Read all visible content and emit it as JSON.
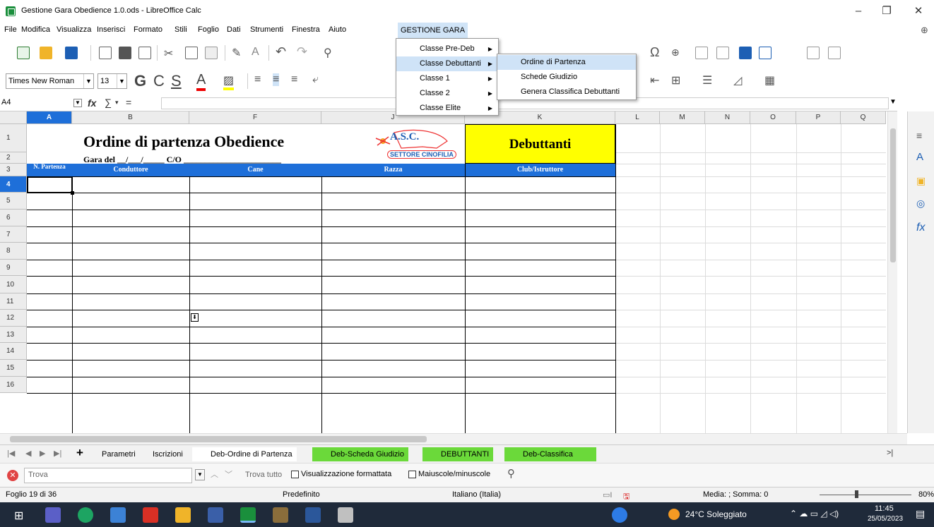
{
  "window": {
    "title": "Gestione Gara Obedience 1.0.ods - LibreOffice Calc"
  },
  "menubar": [
    "File",
    "Modifica",
    "Visualizza",
    "Inserisci",
    "Formato",
    "Stili",
    "Foglio",
    "Dati",
    "Strumenti",
    "Finestra",
    "Aiuto",
    "GESTIONE GARA"
  ],
  "toolbar": {
    "font_name": "Times New Roman",
    "font_size": "13"
  },
  "formula_bar": {
    "name_box": "A4",
    "fx_label": "fx",
    "sum_label": "∑",
    "eq_label": "="
  },
  "columns": [
    "A",
    "B",
    "F",
    "J",
    "K",
    "L",
    "M",
    "N",
    "O",
    "P",
    "Q"
  ],
  "rows": [
    "1",
    "2",
    "3",
    "4",
    "5",
    "6",
    "7",
    "8",
    "9",
    "10",
    "11",
    "12",
    "13",
    "14",
    "15",
    "16"
  ],
  "sheet": {
    "title": "Ordine di partenza Obedience",
    "gara_line": "Gara del __/___/_____ C/O _______________________",
    "category": "Debuttanti",
    "logo_top": "A.S.C.",
    "logo_bottom": "SETTORE CINOFILIA",
    "headers": [
      "N. Partenza",
      "Conduttore",
      "Cane",
      "Razza",
      "Club/Istruttore"
    ]
  },
  "gestione_menu": [
    {
      "label": "Classe Pre-Deb"
    },
    {
      "label": "Classe Debuttanti"
    },
    {
      "label": "Classe 1"
    },
    {
      "label": "Classe 2"
    },
    {
      "label": "Classe Elite"
    }
  ],
  "submenu": [
    "Ordine di Partenza",
    "Schede Giudizio",
    "Genera Classifica Debuttanti"
  ],
  "tabs": [
    "Parametri",
    "Iscrizioni",
    "Deb-Ordine di Partenza",
    "Deb-Scheda Giudizio",
    "DEBUTTANTI",
    "Deb-Classifica"
  ],
  "findbar": {
    "placeholder": "Trova",
    "find_all": "Trova tutto",
    "formatted": "Visualizzazione formattata",
    "case": "Maiuscole/minuscole"
  },
  "status": {
    "sheet": "Foglio 19 di 36",
    "style": "Predefinito",
    "lang": "Italiano (Italia)",
    "sum": "Media: ; Somma: 0",
    "zoom": "80%"
  },
  "taskbar": {
    "weather": "24°C Soleggiato",
    "time": "11:45",
    "date": "25/05/2023"
  }
}
